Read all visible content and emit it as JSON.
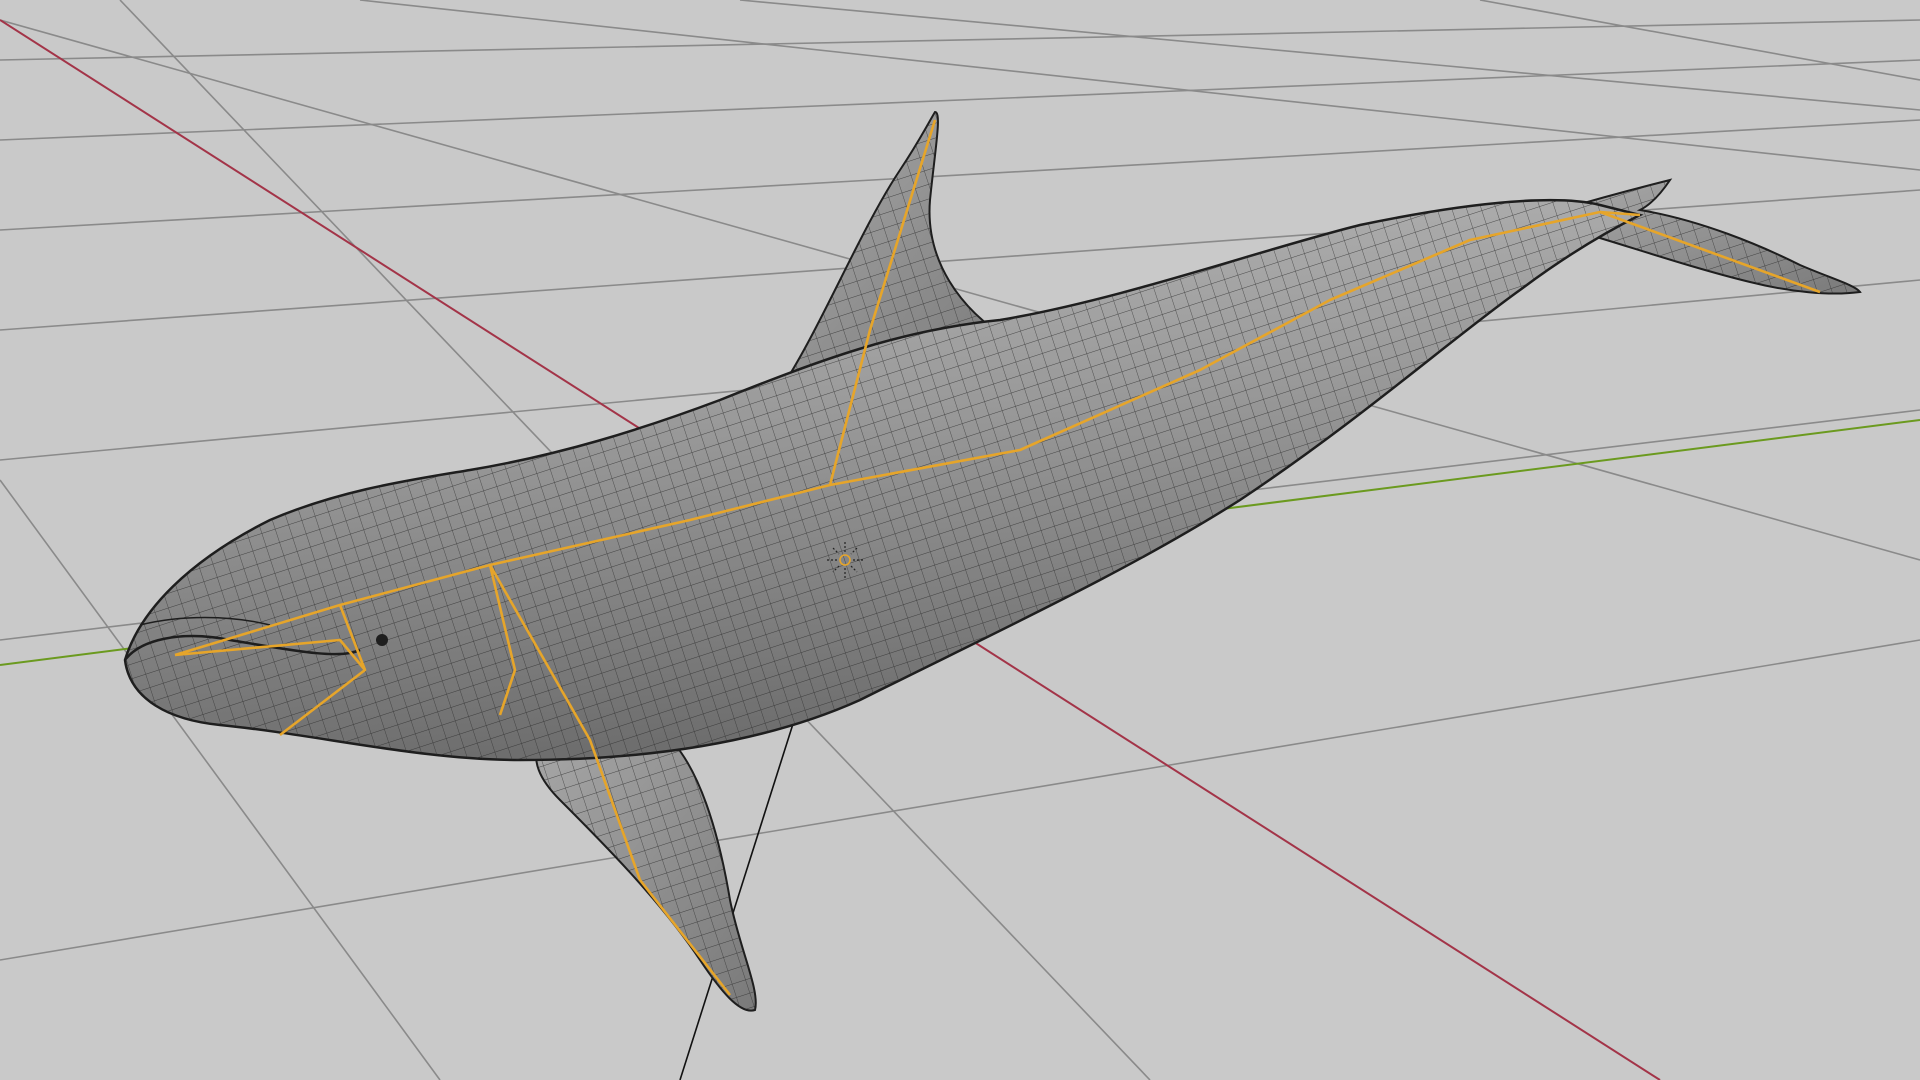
{
  "viewport": {
    "background": "#c9c9c9",
    "grid_color": "#8a8a8a",
    "x_axis_color": "#a33448",
    "y_axis_color": "#6b9a1f"
  },
  "object": {
    "name": "",
    "mesh_base_color": "#8c8c8c",
    "mesh_highlight_color": "#b4b4b4",
    "wire_color": "#1e1e1e",
    "armature_color": "#e6a52a"
  }
}
